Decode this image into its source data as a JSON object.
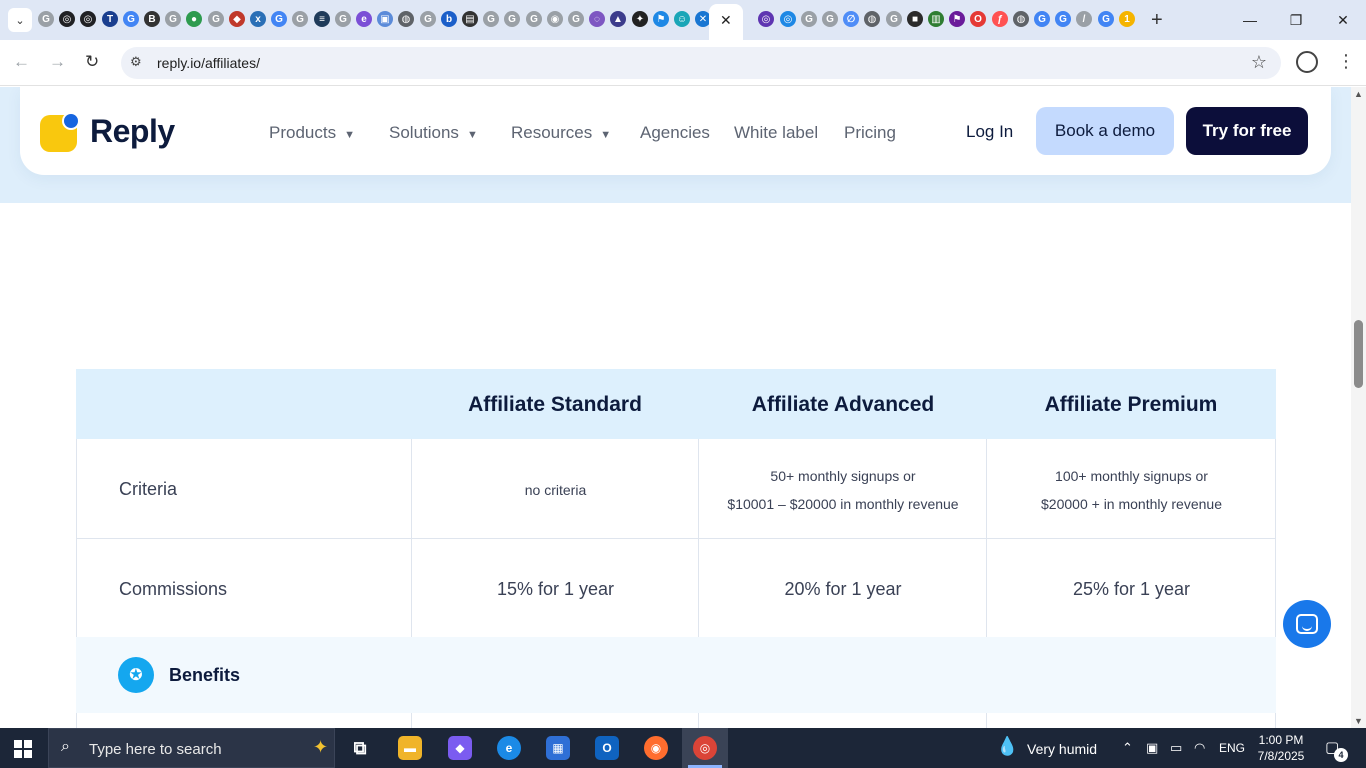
{
  "browser": {
    "url": "reply.io/affiliates/",
    "tab_close": "✕",
    "new_tab": "+",
    "nav_back": "←",
    "nav_forward": "→",
    "nav_reload": "↻",
    "star": "☆",
    "menu": "⋮",
    "tab_search": "⌄",
    "window_minimize": "—",
    "window_restore": "❐",
    "window_close": "✕",
    "tab_favicons": [
      {
        "name": "google-favicon",
        "glyph": "G",
        "color": "#9aa0a6"
      },
      {
        "name": "openai-favicon",
        "glyph": "◎",
        "color": "#202124"
      },
      {
        "name": "openai-favicon",
        "glyph": "◎",
        "color": "#202124"
      },
      {
        "name": "ttp-favicon",
        "glyph": "T",
        "color": "#1a3f8f"
      },
      {
        "name": "google-favicon",
        "glyph": "G",
        "color": "#4285f4"
      },
      {
        "name": "b-favicon",
        "glyph": "B",
        "color": "#333333"
      },
      {
        "name": "google-favicon",
        "glyph": "G",
        "color": "#9aa0a6"
      },
      {
        "name": "globe-green-favicon",
        "glyph": "●",
        "color": "#2e9b4f"
      },
      {
        "name": "google-favicon",
        "glyph": "G",
        "color": "#9aa0a6"
      },
      {
        "name": "basket-favicon",
        "glyph": "◆",
        "color": "#c0392b"
      },
      {
        "name": "xf-favicon",
        "glyph": "x",
        "color": "#2a6fb6"
      },
      {
        "name": "google-favicon",
        "glyph": "G",
        "color": "#4285f4"
      },
      {
        "name": "google-favicon",
        "glyph": "G",
        "color": "#9aa0a6"
      },
      {
        "name": "stack-favicon",
        "glyph": "≡",
        "color": "#1f3b5a"
      },
      {
        "name": "google-favicon",
        "glyph": "G",
        "color": "#9aa0a6"
      },
      {
        "name": "e-favicon",
        "glyph": "e",
        "color": "#7b4fd6"
      },
      {
        "name": "image-favicon",
        "glyph": "▣",
        "color": "#5b8bd9"
      },
      {
        "name": "globe-favicon",
        "glyph": "◍",
        "color": "#5f6368"
      },
      {
        "name": "google-favicon",
        "glyph": "G",
        "color": "#9aa0a6"
      },
      {
        "name": "bing-favicon",
        "glyph": "b",
        "color": "#1b5fc9"
      },
      {
        "name": "doc-favicon",
        "glyph": "▤",
        "color": "#333333"
      },
      {
        "name": "google-favicon",
        "glyph": "G",
        "color": "#9aa0a6"
      },
      {
        "name": "google-favicon",
        "glyph": "G",
        "color": "#9aa0a6"
      },
      {
        "name": "google-favicon",
        "glyph": "G",
        "color": "#9aa0a6"
      },
      {
        "name": "circle-favicon",
        "glyph": "◉",
        "color": "#9aa0a6"
      },
      {
        "name": "google-favicon",
        "glyph": "G",
        "color": "#9aa0a6"
      },
      {
        "name": "chat-favicon",
        "glyph": "◌",
        "color": "#7e57c2"
      },
      {
        "name": "triangle-favicon",
        "glyph": "▲",
        "color": "#3c3c8c"
      },
      {
        "name": "sparkle-favicon",
        "glyph": "✦",
        "color": "#222222"
      },
      {
        "name": "flag-favicon",
        "glyph": "⚑",
        "color": "#1e88e5"
      },
      {
        "name": "person-favicon",
        "glyph": "☺",
        "color": "#1aa6b7"
      },
      {
        "name": "x-blue-favicon",
        "glyph": "✕",
        "color": "#1976d2"
      },
      {
        "name": "chat-purple-favicon",
        "glyph": "◎",
        "color": "#5e35b1"
      },
      {
        "name": "target-favicon",
        "glyph": "◎",
        "color": "#1e88e5"
      },
      {
        "name": "google-favicon",
        "glyph": "G",
        "color": "#9aa0a6"
      },
      {
        "name": "google-favicon",
        "glyph": "G",
        "color": "#9aa0a6"
      },
      {
        "name": "perplexity-favicon",
        "glyph": "∅",
        "color": "#4f8df7"
      },
      {
        "name": "globe-favicon",
        "glyph": "◍",
        "color": "#5f6368"
      },
      {
        "name": "google-favicon",
        "glyph": "G",
        "color": "#9aa0a6"
      },
      {
        "name": "square-green-favicon",
        "glyph": "■",
        "color": "#2b2b2b"
      },
      {
        "name": "chart-favicon",
        "glyph": "▥",
        "color": "#2f7d32"
      },
      {
        "name": "flag-purple-favicon",
        "glyph": "⚑",
        "color": "#6a1b9a"
      },
      {
        "name": "opera-favicon",
        "glyph": "O",
        "color": "#e53935"
      },
      {
        "name": "f-favicon",
        "glyph": "ƒ",
        "color": "#ff5252"
      },
      {
        "name": "globe-favicon",
        "glyph": "◍",
        "color": "#5f6368"
      },
      {
        "name": "google-favicon",
        "glyph": "G",
        "color": "#4285f4"
      },
      {
        "name": "google-favicon",
        "glyph": "G",
        "color": "#4285f4"
      },
      {
        "name": "pen-favicon",
        "glyph": "/",
        "color": "#9aa0a6"
      },
      {
        "name": "google-favicon",
        "glyph": "G",
        "color": "#4285f4"
      },
      {
        "name": "yellow-favicon",
        "glyph": "1",
        "color": "#f5b400"
      }
    ]
  },
  "site": {
    "brand": "Reply",
    "colors": {
      "brand_yellow": "#f9c80e",
      "brand_blue": "#1665e0",
      "navy": "#0c0e3a",
      "demo_bg": "#c4dafe"
    },
    "nav": [
      {
        "label": "Products",
        "dropdown": true
      },
      {
        "label": "Solutions",
        "dropdown": true
      },
      {
        "label": "Resources",
        "dropdown": true
      },
      {
        "label": "Agencies",
        "dropdown": false
      },
      {
        "label": "White label",
        "dropdown": false
      },
      {
        "label": "Pricing",
        "dropdown": false
      }
    ],
    "login": "Log In",
    "book_demo": "Book a demo",
    "try_free": "Try for free"
  },
  "table": {
    "headers": [
      "Affiliate Standard",
      "Affiliate Advanced",
      "Affiliate Premium"
    ],
    "rows": [
      {
        "label": "Criteria",
        "cells": [
          [
            "no criteria"
          ],
          [
            "50+ monthly signups or",
            "$10001 – $20000 in monthly revenue"
          ],
          [
            "100+ monthly signups or",
            "$20000 + in monthly revenue"
          ]
        ]
      },
      {
        "label": "Commissions",
        "cells": [
          [
            "15% for 1 year"
          ],
          [
            "20% for 1 year"
          ],
          [
            "25% for 1 year"
          ]
        ]
      }
    ],
    "section": "Benefits"
  },
  "taskbar": {
    "search_placeholder": "Type here to search",
    "weather": "Very humid",
    "language": "ENG",
    "time": "1:00 PM",
    "date": "7/8/2025",
    "notifications": "4"
  }
}
